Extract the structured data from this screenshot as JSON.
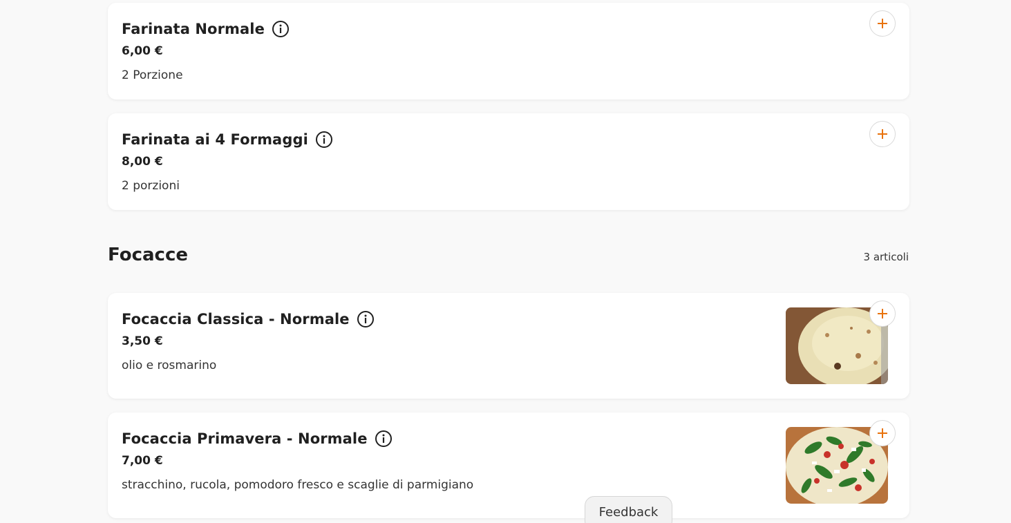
{
  "colors": {
    "accent": "#e8720c",
    "card_bg": "#ffffff",
    "page_bg": "#f9f9f9",
    "text": "#202020"
  },
  "icons": {
    "info": "info-icon",
    "add": "plus-icon"
  },
  "items_before": [
    {
      "name": "Farinata Normale",
      "price": "6,00 €",
      "description": "2 Porzione"
    },
    {
      "name": "Farinata ai 4 Formaggi",
      "price": "8,00 €",
      "description": "2 porzioni"
    }
  ],
  "section": {
    "title": "Focacce",
    "count": "3 articoli",
    "items": [
      {
        "name": "Focaccia Classica - Normale",
        "price": "3,50 €",
        "description": "olio e rosmarino"
      },
      {
        "name": "Focaccia Primavera - Normale",
        "price": "7,00 €",
        "description": "stracchino, rucola, pomodoro fresco e scaglie di parmigiano"
      }
    ]
  },
  "feedback": {
    "label": "Feedback"
  }
}
